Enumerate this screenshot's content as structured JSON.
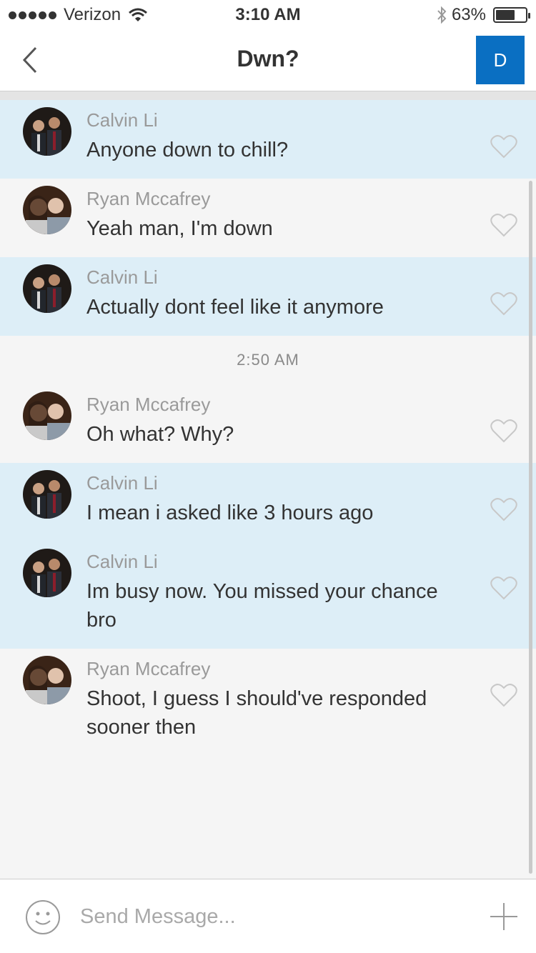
{
  "status_bar": {
    "carrier": "Verizon",
    "time": "3:10 AM",
    "battery": "63%",
    "battery_level": 0.63
  },
  "nav": {
    "title": "Dwn?",
    "avatar_letter": "D",
    "avatar_color": "#0a6fc2"
  },
  "messages": [
    {
      "sender": "Calvin Li",
      "text": "Anyone down to chill?"
    },
    {
      "sender": "Ryan Mccafrey",
      "text": "Yeah man, I'm down"
    },
    {
      "sender": "Calvin Li",
      "text": "Actually dont feel like it anymore"
    },
    {
      "timestamp": "2:50 AM"
    },
    {
      "sender": "Ryan Mccafrey",
      "text": "Oh what? Why?"
    },
    {
      "sender": "Calvin Li",
      "text": "I mean i asked like 3 hours ago"
    },
    {
      "sender": "Calvin Li",
      "text": "Im busy now. You missed your chance bro"
    },
    {
      "sender": "Ryan Mccafrey",
      "text": "Shoot, I guess I should've responded sooner then"
    }
  ],
  "composer": {
    "placeholder": "Send Message..."
  },
  "colors": {
    "highlight": "#ddeef7",
    "accent": "#0a6fc2"
  },
  "icons": [
    "back-chevron-icon",
    "heart-icon",
    "emoji-icon",
    "plus-icon",
    "wifi-icon",
    "bluetooth-icon",
    "battery-icon"
  ]
}
